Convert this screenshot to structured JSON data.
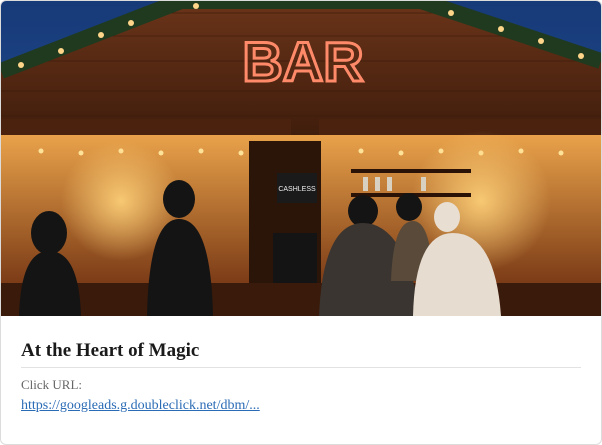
{
  "ad": {
    "image_sign": "BAR",
    "cashless_sign": "CASHLESS",
    "title": "At the Heart of Magic",
    "click_url_label": "Click URL:",
    "click_url": "https://googleads.g.doubleclick.net/dbm/..."
  },
  "colors": {
    "sky": "#1c3f7a",
    "wood": "#5a2c14",
    "neon": "#ff7a5a",
    "link": "#2a6bb5"
  }
}
